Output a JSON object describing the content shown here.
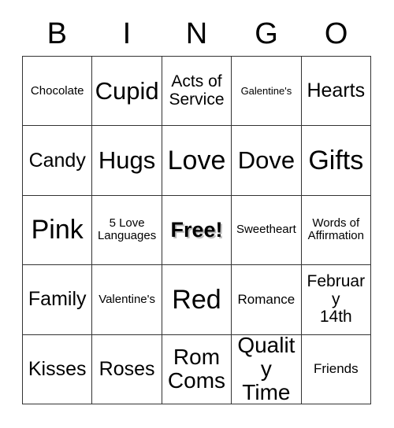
{
  "card": {
    "header_letters": [
      "B",
      "I",
      "N",
      "G",
      "O"
    ],
    "grid_size": 5,
    "text_color": "#000000",
    "border_color": "#333333",
    "background_color": "#ffffff",
    "rows": [
      [
        {
          "label": "Chocolate",
          "size": "fs-sm",
          "free": false
        },
        {
          "label": "Cupid",
          "size": "fs-3xl",
          "free": false
        },
        {
          "label": "Acts of\nService",
          "size": "fs-lg",
          "free": false
        },
        {
          "label": "Galentine's",
          "size": "fs-xs",
          "free": false
        },
        {
          "label": "Hearts",
          "size": "fs-xl",
          "free": false
        }
      ],
      [
        {
          "label": "Candy",
          "size": "fs-xl",
          "free": false
        },
        {
          "label": "Hugs",
          "size": "fs-3xl",
          "free": false
        },
        {
          "label": "Love",
          "size": "fs-4xl",
          "free": false
        },
        {
          "label": "Dove",
          "size": "fs-3xl",
          "free": false
        },
        {
          "label": "Gifts",
          "size": "fs-4xl",
          "free": false
        }
      ],
      [
        {
          "label": "Pink",
          "size": "fs-4xl",
          "free": false
        },
        {
          "label": "5 Love\nLanguages",
          "size": "fs-sm",
          "free": false
        },
        {
          "label": "Free!",
          "size": "fs-2xl",
          "free": true
        },
        {
          "label": "Sweetheart",
          "size": "fs-sm",
          "free": false
        },
        {
          "label": "Words of\nAffirmation",
          "size": "fs-sm",
          "free": false
        }
      ],
      [
        {
          "label": "Family",
          "size": "fs-xl",
          "free": false
        },
        {
          "label": "Valentine's",
          "size": "fs-sm",
          "free": false
        },
        {
          "label": "Red",
          "size": "fs-4xl",
          "free": false
        },
        {
          "label": "Romance",
          "size": "fs-md",
          "free": false
        },
        {
          "label": "February\n14th",
          "size": "fs-lg",
          "free": false
        }
      ],
      [
        {
          "label": "Kisses",
          "size": "fs-xl",
          "free": false
        },
        {
          "label": "Roses",
          "size": "fs-xl",
          "free": false
        },
        {
          "label": "Rom\nComs",
          "size": "fs-2xl",
          "free": false
        },
        {
          "label": "Quality\nTime",
          "size": "fs-2xl",
          "free": false
        },
        {
          "label": "Friends",
          "size": "fs-md",
          "free": false
        }
      ]
    ]
  }
}
